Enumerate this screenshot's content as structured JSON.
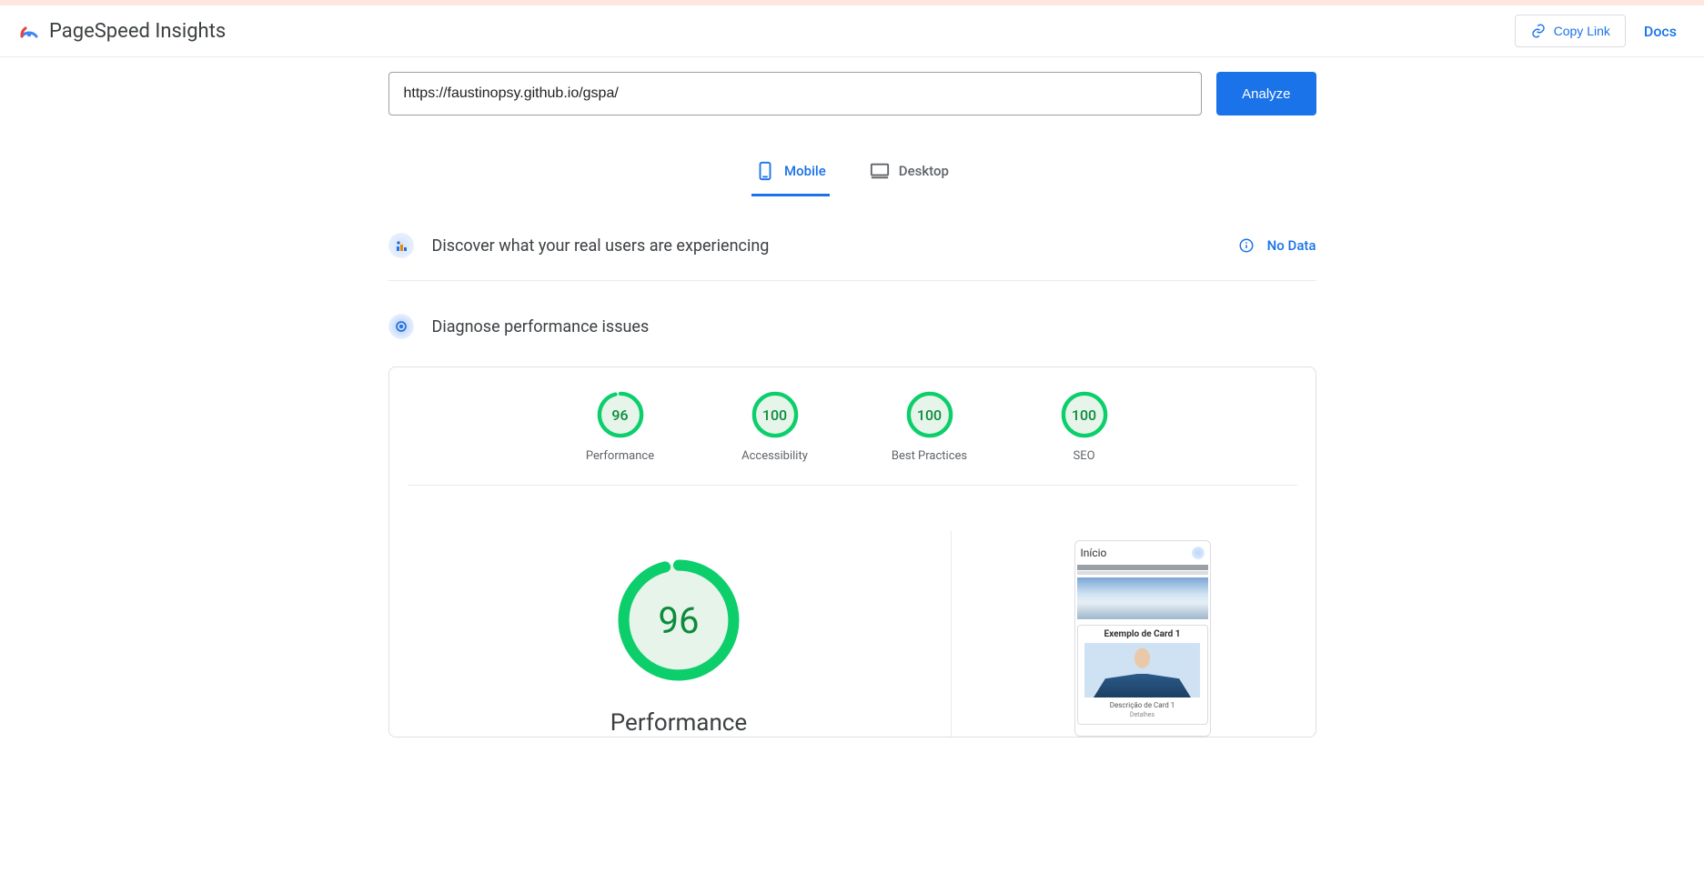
{
  "header": {
    "title": "PageSpeed Insights",
    "copy_link_label": "Copy Link",
    "docs_label": "Docs"
  },
  "url_input": {
    "value": "https://faustinopsy.github.io/gspa/"
  },
  "analyze_label": "Analyze",
  "tabs": {
    "mobile": "Mobile",
    "desktop": "Desktop"
  },
  "discover": {
    "title": "Discover what your real users are experiencing",
    "no_data": "No Data"
  },
  "diagnose": {
    "title": "Diagnose performance issues"
  },
  "scores": [
    {
      "label": "Performance",
      "value": "96",
      "fraction": 0.96
    },
    {
      "label": "Accessibility",
      "value": "100",
      "fraction": 1.0
    },
    {
      "label": "Best Practices",
      "value": "100",
      "fraction": 1.0
    },
    {
      "label": "SEO",
      "value": "100",
      "fraction": 1.0
    }
  ],
  "big_score": {
    "value": "96",
    "label": "Performance",
    "fraction": 0.96
  },
  "preview": {
    "head": "Início",
    "card_title": "Exemplo de Card 1",
    "card_desc": "Descrição de Card 1",
    "card_link": "Detalhes"
  }
}
